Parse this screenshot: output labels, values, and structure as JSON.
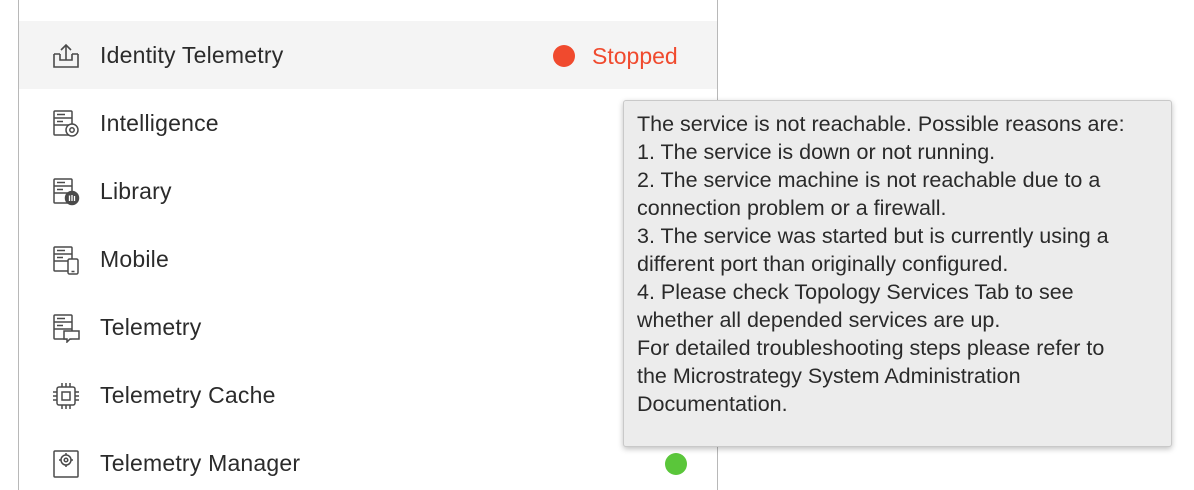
{
  "services": [
    {
      "label": "Identity Telemetry",
      "icon": "upload-tray-icon",
      "status": "Stopped",
      "status_color": "#f04a2e",
      "selected": true
    },
    {
      "label": "Intelligence",
      "icon": "server-gear-icon"
    },
    {
      "label": "Library",
      "icon": "server-library-icon"
    },
    {
      "label": "Mobile",
      "icon": "server-mobile-icon"
    },
    {
      "label": "Telemetry",
      "icon": "server-chat-icon"
    },
    {
      "label": "Telemetry Cache",
      "icon": "chip-icon"
    },
    {
      "label": "Telemetry Manager",
      "icon": "gear-box-icon",
      "status_color": "#5ac63a"
    }
  ],
  "tooltip": {
    "lines": [
      "The service is not reachable. Possible reasons are:",
      "1. The service is down or not running.",
      "2. The service machine is not reachable due to a",
      "connection problem or a firewall.",
      "3. The service was started but is currently using a",
      "different port than originally configured.",
      "4. Please check Topology Services Tab to see",
      "whether all depended services are up.",
      "For detailed troubleshooting steps please refer to",
      "the Microstrategy System Administration",
      "Documentation."
    ]
  },
  "colors": {
    "stopped": "#f04a2e",
    "running": "#5ac63a",
    "selected_row": "#f4f4f4",
    "tooltip_bg": "#ececec"
  }
}
